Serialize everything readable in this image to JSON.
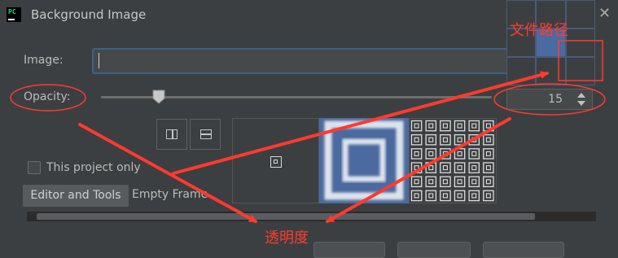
{
  "window": {
    "title": "Background Image",
    "app_icon_text": "PC"
  },
  "form": {
    "image_label": "Image:",
    "image_value": "",
    "browse_label": "...",
    "opacity_label": "Opacity:",
    "opacity_value": "15",
    "opacity_fraction": 0.15
  },
  "options": {
    "this_project_only_label": "This project only",
    "this_project_only_checked": false
  },
  "tabs": [
    {
      "label": "Editor and Tools",
      "selected": true
    },
    {
      "label": "Empty Frame",
      "selected": false
    }
  ],
  "annotations": {
    "file_path": "文件路径",
    "opacity": "透明度",
    "color": "#ff3a2e"
  }
}
